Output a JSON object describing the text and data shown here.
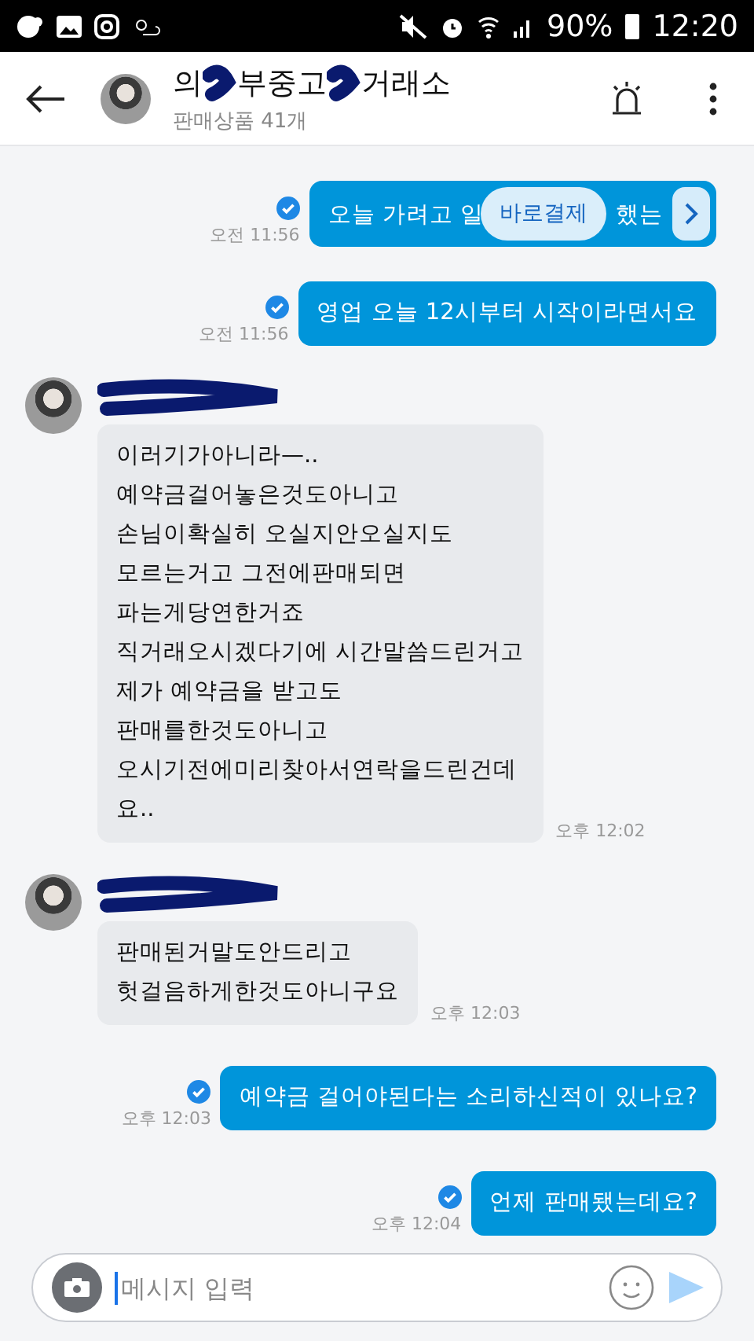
{
  "status_bar": {
    "battery": "90%",
    "time": "12:20"
  },
  "header": {
    "title_parts": [
      "의",
      "부중고",
      "거래소"
    ],
    "subtitle": "판매상품 41개"
  },
  "messages": [
    {
      "kind": "pay",
      "read": true,
      "time": "오전 11:56",
      "text_before": "오늘 가려고 일",
      "text_after": "했는",
      "pay_label": "바로결제"
    },
    {
      "kind": "sent",
      "read": true,
      "time": "오전 11:56",
      "text": "영업 오늘 12시부터 시작이라면서요"
    },
    {
      "kind": "received",
      "time": "오후 12:02",
      "text": "이러기가아니라—..\n예약금걸어놓은것도아니고\n손님이확실히 오실지안오실지도\n모르는거고 그전에판매되면\n파는게당연한거죠\n직거래오시겠다기에 시간말씀드린거고\n제가 예약금을 받고도\n판매를한것도아니고\n오시기전에미리찾아서연락을드린건데\n요.."
    },
    {
      "kind": "received",
      "time": "오후 12:03",
      "text": "판매된거말도안드리고\n헛걸음하게한것도아니구요"
    },
    {
      "kind": "sent",
      "read": true,
      "time": "오후 12:03",
      "text": "예약금 걸어야된다는 소리하신적이 있나요?"
    },
    {
      "kind": "sent",
      "read": true,
      "time": "오후 12:04",
      "text": "언제 판매됐는데요?"
    }
  ],
  "composer": {
    "placeholder": "메시지 입력"
  }
}
